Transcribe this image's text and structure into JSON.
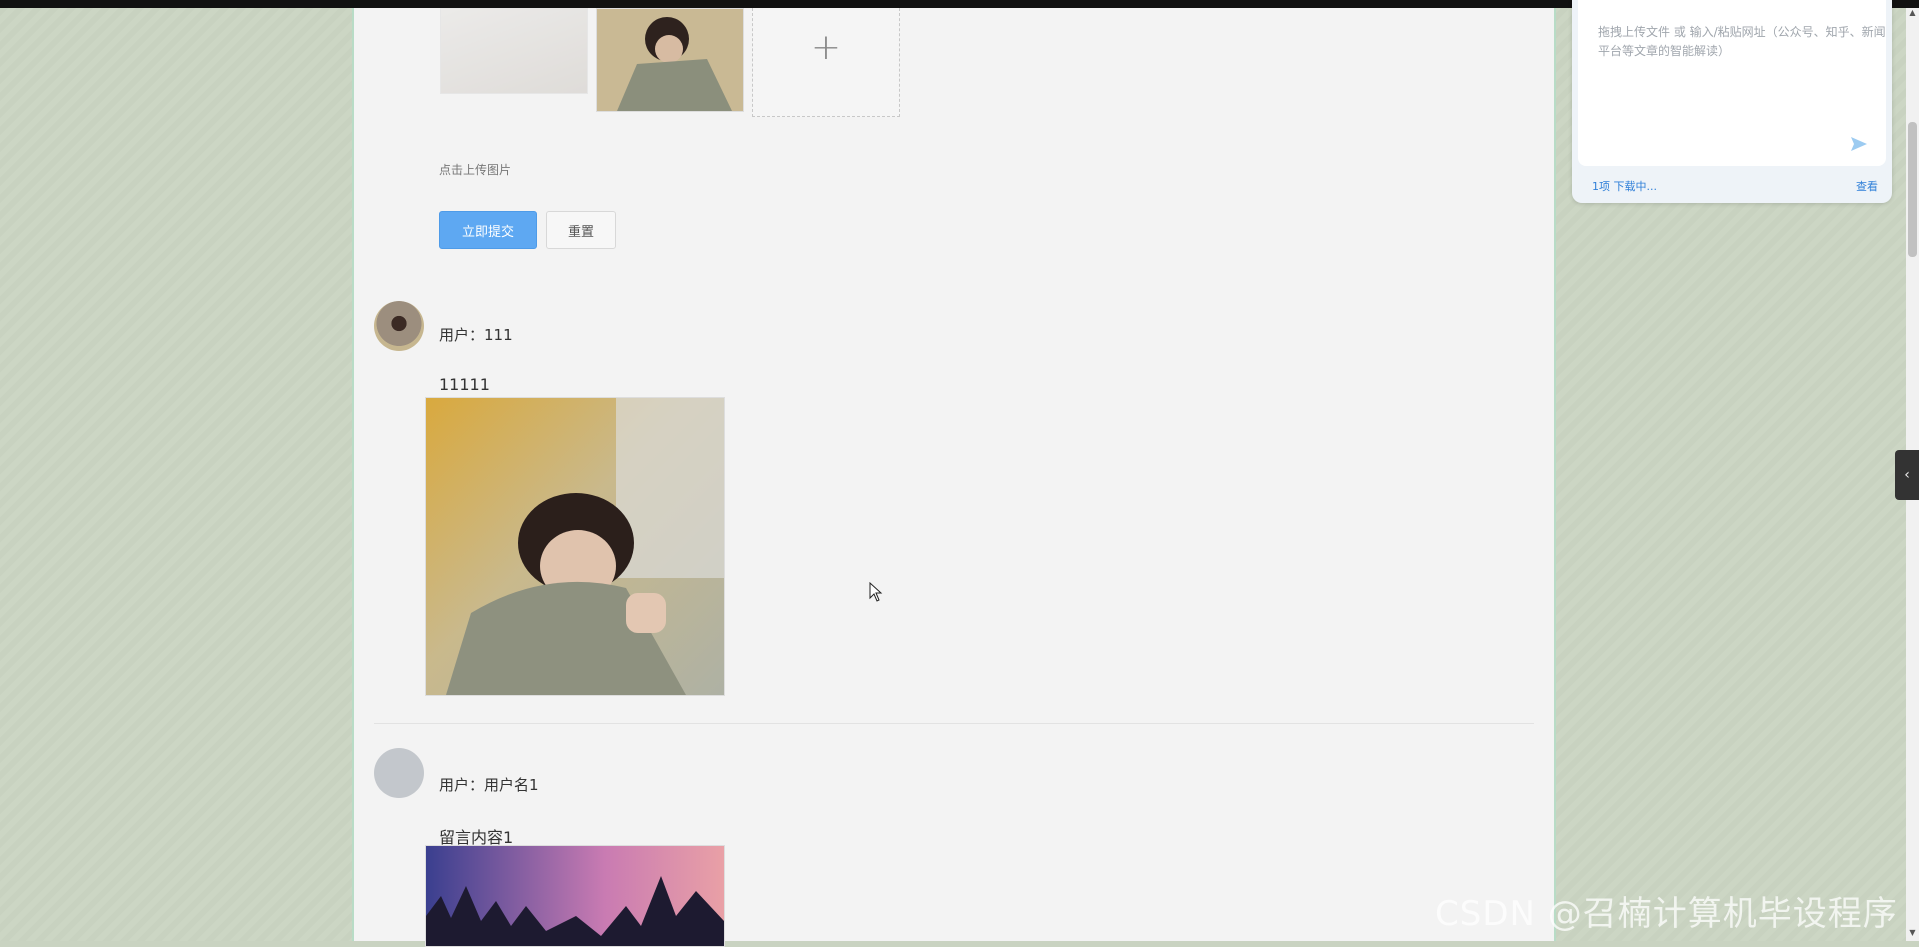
{
  "upload": {
    "tip": "点击上传图片",
    "add_icon": "plus-icon"
  },
  "form": {
    "submit_label": "立即提交",
    "reset_label": "重置"
  },
  "messages": [
    {
      "user_label": "用户：111",
      "content": "11111"
    },
    {
      "user_label": "用户：用户名1",
      "content": "留言内容1"
    }
  ],
  "side_panel": {
    "placeholder": "拖拽上传文件 或 输入/粘贴网址（公众号、知乎、新闻平台等文章的智能解读）",
    "download_status": "1项 下载中...",
    "view_label": "查看",
    "send_icon": "send-icon"
  },
  "sidebar_toggle": {
    "icon": "chevron-left-icon",
    "glyph": "‹"
  },
  "watermark": "CSDN @召楠计算机毕设程序",
  "colors": {
    "primary_button": "#5ea8f2",
    "page_background": "#c9d3c1",
    "panel_background": "#f3f3f3",
    "link_blue": "#2f7fd8"
  }
}
